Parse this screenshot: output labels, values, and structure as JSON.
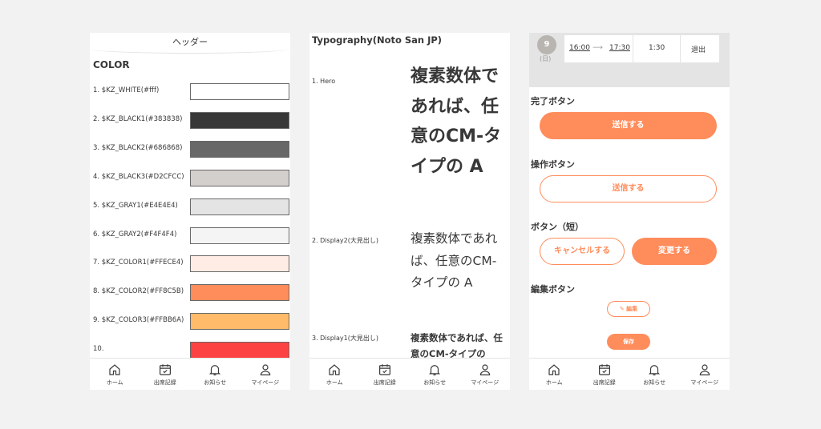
{
  "nav": [
    {
      "label": "ホーム",
      "icon": "home-icon"
    },
    {
      "label": "出席記録",
      "icon": "calendar-icon"
    },
    {
      "label": "お知らせ",
      "icon": "bell-icon"
    },
    {
      "label": "マイページ",
      "icon": "person-icon"
    }
  ],
  "colors_screen": {
    "header": "ヘッダー",
    "title": "COLOR",
    "swatches": [
      {
        "label": "1. $KZ_WHITE(#fff)",
        "color": "#ffffff"
      },
      {
        "label": "2. $KZ_BLACK1(#383838)",
        "color": "#383838"
      },
      {
        "label": "3. $KZ_BLACK2(#686868)",
        "color": "#686868"
      },
      {
        "label": "4. $KZ_BLACK3(#D2CFCC)",
        "color": "#D2CFCC"
      },
      {
        "label": "5. $KZ_GRAY1(#E4E4E4)",
        "color": "#E4E4E4"
      },
      {
        "label": "6. $KZ_GRAY2(#F4F4F4)",
        "color": "#F4F4F4"
      },
      {
        "label": "7. $KZ_COLOR1(#FFECE4)",
        "color": "#FFECE4"
      },
      {
        "label": "8. $KZ_COLOR2(#FF8C5B)",
        "color": "#FF8C5B"
      },
      {
        "label": "9. $KZ_COLOR3(#FFBB6A)",
        "color": "#FFBB6A"
      },
      {
        "label": "10.",
        "color": "#FC4242"
      }
    ]
  },
  "typography_screen": {
    "title": "Typography(Noto San JP)",
    "hero_label": "1. Hero",
    "hero_sample": "複素数体であれば、任意のCM-タイプの A",
    "display2_label": "2. Display2(大見出し)",
    "display2_sample": "複素数体であれば、任意のCM-タイプの A",
    "display1_label": "3. Display1(大見出し)",
    "display1_sample": "複素数体であれば、任意のCM-タイプの"
  },
  "buttons_screen": {
    "day_number": "9",
    "day_of_week": "(日)",
    "start_time": "16:00",
    "arrow": "⟶",
    "end_time": "17:30",
    "duration": "1:30",
    "exit_label": "退出",
    "complete_label": "完了ボタン",
    "complete_button": "送信する",
    "operation_label": "操作ボタン",
    "operation_button": "送信する",
    "short_label": "ボタン（短）",
    "cancel_button": "キャンセルする",
    "change_button": "変更する",
    "edit_label": "編集ボタン",
    "edit_button": "編集",
    "save_button": "保存"
  }
}
